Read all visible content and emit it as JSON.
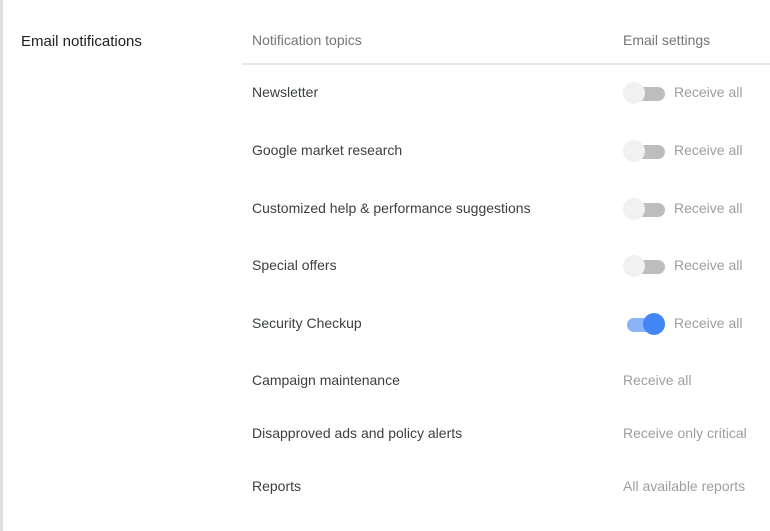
{
  "section_title": "Email notifications",
  "headers": {
    "topics": "Notification topics",
    "settings": "Email settings"
  },
  "colors": {
    "accent": "#4285f4",
    "track_on": "#8ab4f8",
    "track_off": "#bdbdbd"
  },
  "rows": [
    {
      "topic": "Newsletter",
      "setting": "Receive all",
      "toggle": false
    },
    {
      "topic": "Google market research",
      "setting": "Receive all",
      "toggle": false
    },
    {
      "topic": "Customized help & performance suggestions",
      "setting": "Receive all",
      "toggle": false
    },
    {
      "topic": "Special offers",
      "setting": "Receive all",
      "toggle": false
    },
    {
      "topic": "Security Checkup",
      "setting": "Receive all",
      "toggle": true
    },
    {
      "topic": "Campaign maintenance",
      "setting": "Receive all"
    },
    {
      "topic": "Disapproved ads and policy alerts",
      "setting": "Receive only critical"
    },
    {
      "topic": "Reports",
      "setting": "All available reports"
    }
  ]
}
